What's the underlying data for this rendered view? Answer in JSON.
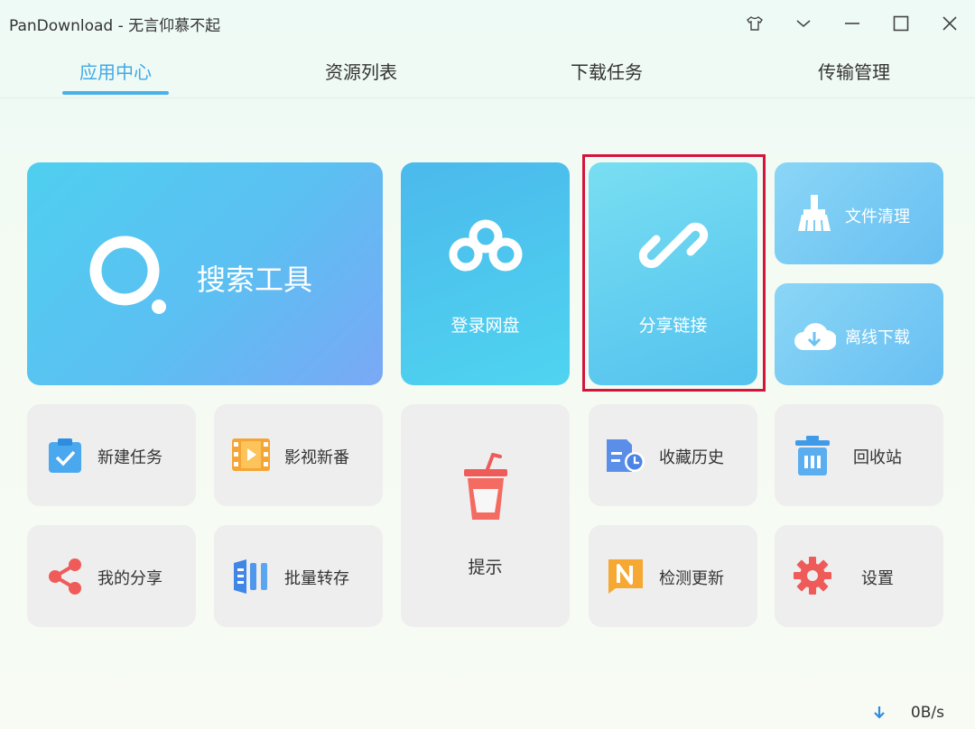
{
  "window": {
    "title": "PanDownload - 无言仰慕不起"
  },
  "tabs": [
    {
      "label": "应用中心",
      "active": true
    },
    {
      "label": "资源列表",
      "active": false
    },
    {
      "label": "下载任务",
      "active": false
    },
    {
      "label": "传输管理",
      "active": false
    }
  ],
  "tiles": {
    "search": {
      "label": "搜索工具",
      "icon": "search-icon"
    },
    "login": {
      "label": "登录网盘",
      "icon": "cloud-icon"
    },
    "share_link": {
      "label": "分享链接",
      "icon": "link-icon"
    },
    "file_clean": {
      "label": "文件清理",
      "icon": "broom-icon"
    },
    "offline_download": {
      "label": "离线下载",
      "icon": "cloud-download-icon"
    },
    "new_task": {
      "label": "新建任务",
      "icon": "clipboard-check-icon"
    },
    "movies": {
      "label": "影视新番",
      "icon": "film-icon"
    },
    "tips": {
      "label": "提示",
      "icon": "cup-icon"
    },
    "favorites_history": {
      "label": "收藏历史",
      "icon": "history-icon"
    },
    "recycle_bin": {
      "label": "回收站",
      "icon": "trash-icon"
    },
    "my_share": {
      "label": "我的分享",
      "icon": "share-icon"
    },
    "batch_save": {
      "label": "批量转存",
      "icon": "batch-icon"
    },
    "check_update": {
      "label": "检测更新",
      "icon": "update-n-icon"
    },
    "settings": {
      "label": "设置",
      "icon": "gear-icon"
    }
  },
  "status": {
    "speed": "0B/s",
    "icon": "download-arrow-icon"
  },
  "colors": {
    "accent": "#3fa9e8",
    "highlight": "#d4143a",
    "tile_gray": "#eeeeee"
  }
}
